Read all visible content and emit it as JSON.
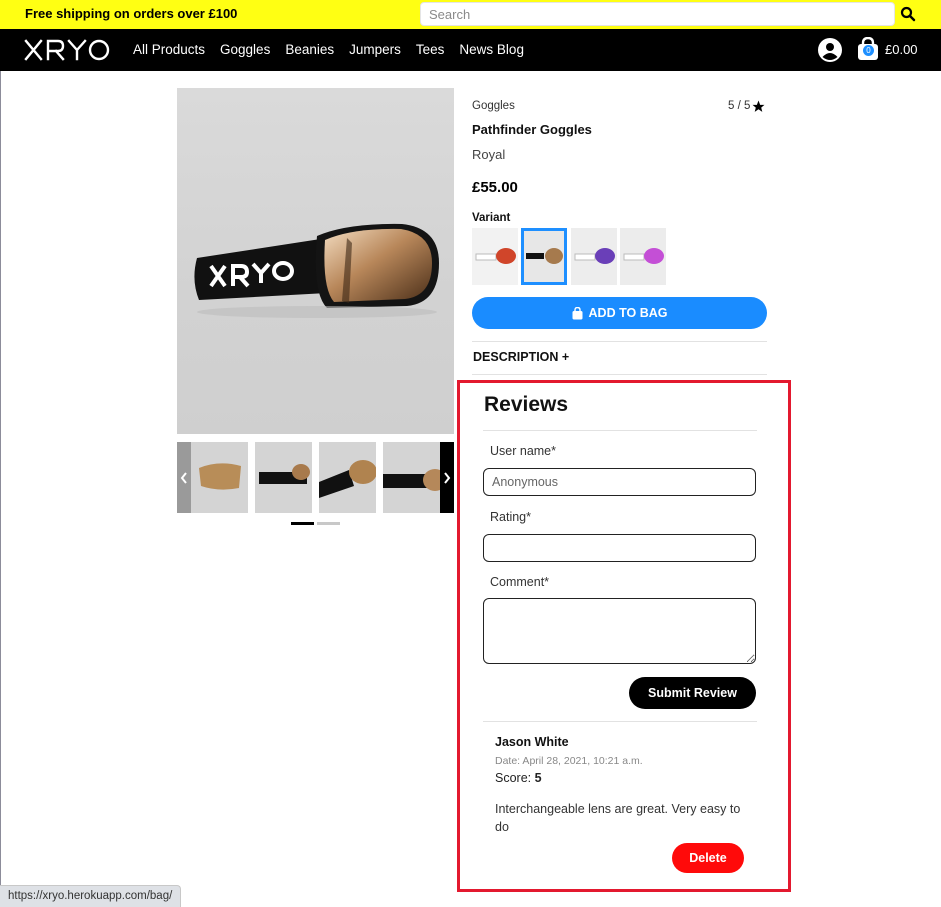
{
  "promo": {
    "text": "Free shipping on orders over £100"
  },
  "search": {
    "placeholder": "Search"
  },
  "nav": {
    "logo": "XRYO",
    "links": [
      "All Products",
      "Goggles",
      "Beanies",
      "Jumpers",
      "Tees",
      "News Blog"
    ],
    "bag_count": "0",
    "bag_total": "£0.00"
  },
  "product": {
    "category": "Goggles",
    "rating": "5 / 5",
    "name": "Pathfinder Goggles",
    "variant": "Royal",
    "price": "£55.00",
    "variant_label": "Variant",
    "variants": [
      "red-orange-lens",
      "royal-gold-lens",
      "purple-lens",
      "pink-lens"
    ],
    "selected_variant": 1,
    "add_to_bag": "ADD TO BAG",
    "description_toggle": "DESCRIPTION +"
  },
  "reviews": {
    "title": "Reviews",
    "username_label": "User name*",
    "username_placeholder": "Anonymous",
    "rating_label": "Rating*",
    "comment_label": "Comment*",
    "submit_label": "Submit Review",
    "items": [
      {
        "author": "Jason White",
        "date": "Date: April 28, 2021, 10:21 a.m.",
        "score_label": "Score:",
        "score": "5",
        "comment": "Interchangeable lens are great. Very easy to do",
        "delete_label": "Delete"
      }
    ]
  },
  "status_bar": {
    "url": "https://xryo.herokuapp.com/bag/"
  },
  "colors": {
    "promo": "#ffff13",
    "accent": "#1a8cff",
    "danger": "#ff0a0a",
    "highlight": "#e3192f"
  }
}
